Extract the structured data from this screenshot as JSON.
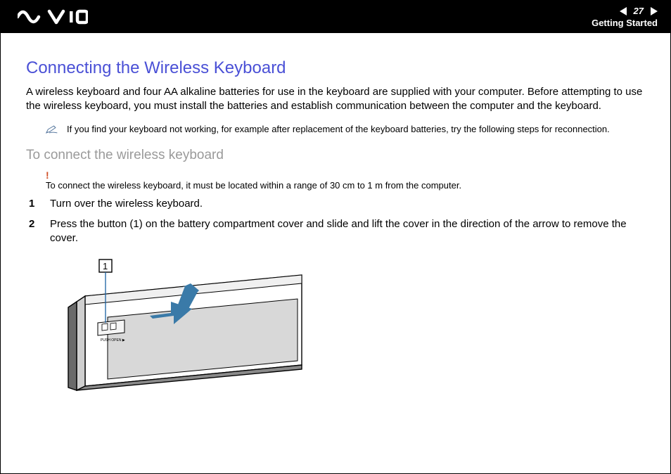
{
  "header": {
    "page_number": "27",
    "section": "Getting Started"
  },
  "body": {
    "heading": "Connecting the Wireless Keyboard",
    "intro": "A wireless keyboard and four AA alkaline batteries for use in the keyboard are supplied with your computer. Before attempting to use the wireless keyboard, you must install the batteries and establish communication between the computer and the keyboard.",
    "note": "If you find your keyboard not working, for example after replacement of the keyboard batteries, try the following steps for reconnection.",
    "subheading": "To connect the wireless keyboard",
    "warning": "To connect the wireless keyboard, it must be located within a range of 30 cm to 1 m from the computer.",
    "steps": [
      "Turn over the wireless keyboard.",
      "Press the button (1) on the battery compartment cover and slide and lift the cover in the direction of the arrow to remove the cover."
    ]
  },
  "figure": {
    "callout_label": "1",
    "button_label": "PUSH OPEN ▶"
  }
}
